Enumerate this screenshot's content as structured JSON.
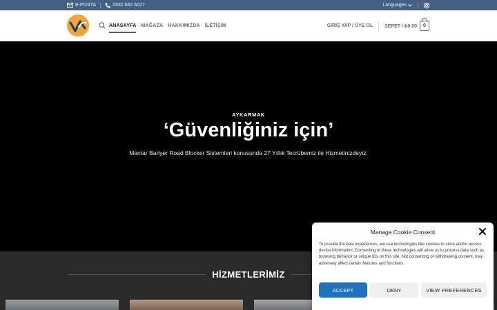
{
  "topbar": {
    "email_label": "E-POSTA",
    "phone": "0532 662 6027",
    "languages_label": "Languages"
  },
  "header": {
    "nav": [
      "ANASAYFA",
      "MAĞAZA",
      "HAKKIMIZDA",
      "İLETİŞİM"
    ],
    "login_label": "GİRİŞ YAP / ÜYE OL",
    "cart_label": "SEPET / ",
    "cart_total": "₺0.00",
    "cart_count": "0"
  },
  "hero": {
    "kicker": "AYKARMAK",
    "title": "‘Güvenliğiniz için’",
    "subtitle": "Mantar Bariyer Road Blocker Sistemleri konusunda 27 Yıllık Tecrübemiz ile Hizmetinizdeyiz."
  },
  "services": {
    "title": "HİZMETLERİMİZ"
  },
  "cookie": {
    "title": "Manage Cookie Consent",
    "text": "To provide the best experiences, we use technologies like cookies to store and/or access device information. Consenting to these technologies will allow us to process data such as browsing behavior or unique IDs on this site. Not consenting or withdrawing consent, may adversely affect certain features and functions.",
    "accept": "ACCEPT",
    "deny": "DENY",
    "preferences": "VIEW PREFERENCES"
  },
  "colors": {
    "topbar": "#446084",
    "accept": "#1e73be",
    "logo": "#f3a53a"
  }
}
